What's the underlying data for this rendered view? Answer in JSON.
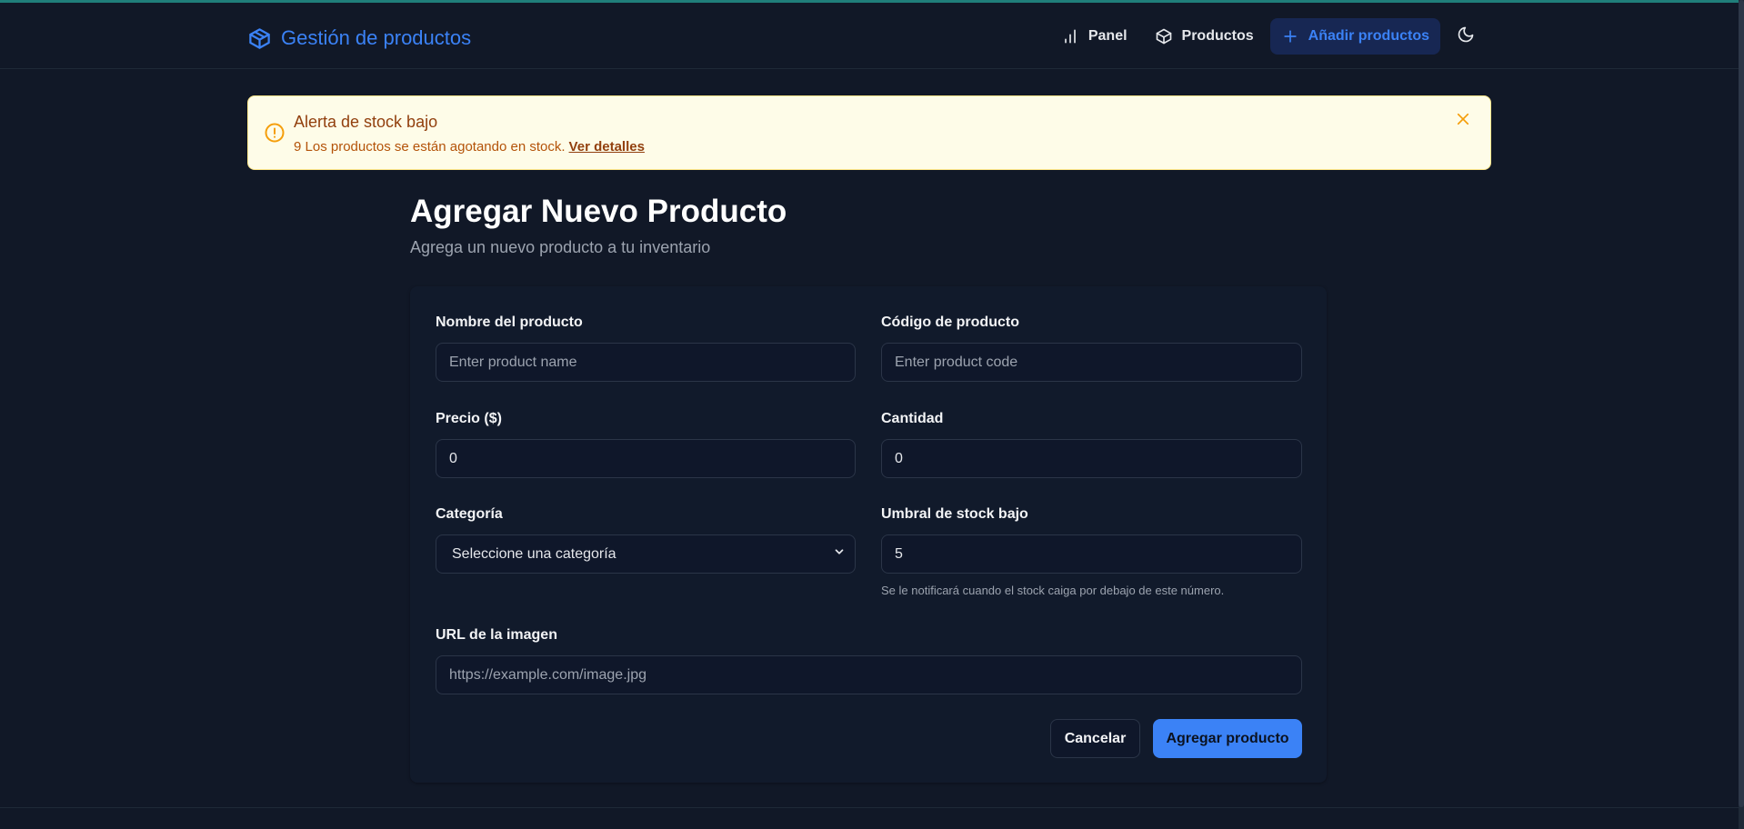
{
  "app": {
    "title": "Gestión de productos"
  },
  "nav": {
    "items": [
      {
        "label": "Panel",
        "icon": "bar-chart-icon"
      },
      {
        "label": "Productos",
        "icon": "box-icon"
      },
      {
        "label": "Añadir productos",
        "icon": "plus-icon",
        "active": true
      }
    ],
    "theme_toggle_icon": "moon-icon"
  },
  "alert": {
    "title": "Alerta de stock bajo",
    "message": "9 Los productos se están agotando en stock.",
    "link": "Ver detalles"
  },
  "page": {
    "title": "Agregar Nuevo Producto",
    "subtitle": "Agrega un nuevo producto a tu inventario"
  },
  "form": {
    "name": {
      "label": "Nombre del producto",
      "placeholder": "Enter product name",
      "value": ""
    },
    "code": {
      "label": "Código de producto",
      "placeholder": "Enter product code",
      "value": ""
    },
    "price": {
      "label": "Precio ($)",
      "value": "0"
    },
    "quantity": {
      "label": "Cantidad",
      "value": "0"
    },
    "category": {
      "label": "Categoría",
      "selected": "Seleccione una categoría"
    },
    "low_stock": {
      "label": "Umbral de stock bajo",
      "value": "5",
      "hint": "Se le notificará cuando el stock caiga por debajo de este número."
    },
    "image_url": {
      "label": "URL de la imagen",
      "placeholder": "https://example.com/image.jpg",
      "value": ""
    },
    "cancel_label": "Cancelar",
    "submit_label": "Agregar producto"
  },
  "colors": {
    "background": "#111827",
    "accent": "#3b82f6",
    "alert_bg": "#fefce8",
    "alert_text": "#92400e"
  }
}
